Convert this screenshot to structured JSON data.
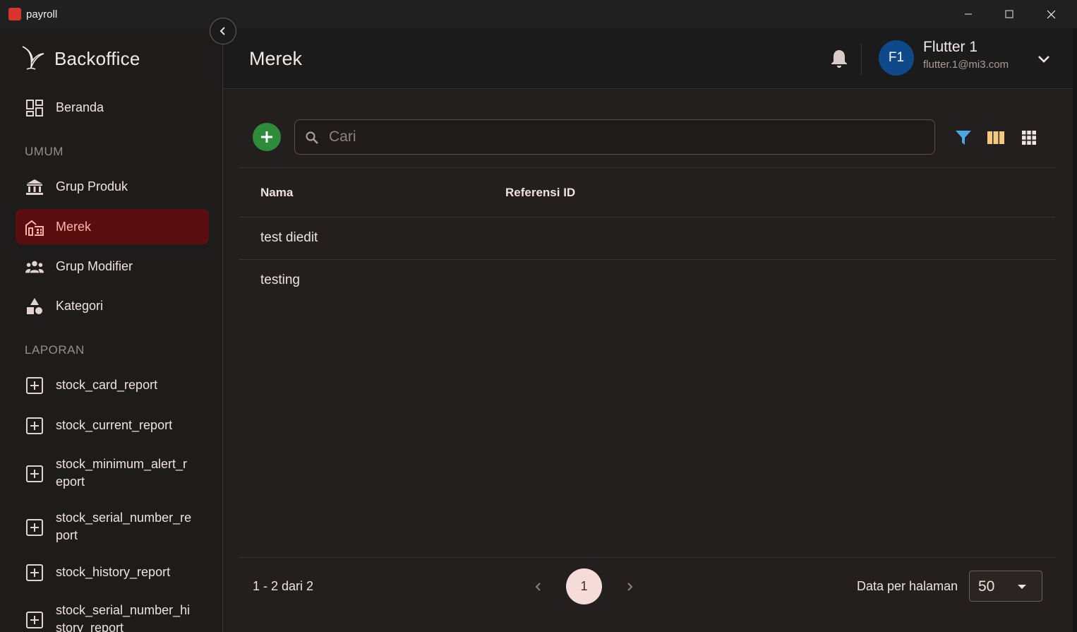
{
  "window": {
    "title": "payroll",
    "accent": "#d9342b"
  },
  "sidebar": {
    "brand": "Backoffice",
    "home": {
      "label": "Beranda",
      "icon": "dashboard-icon"
    },
    "sections": [
      {
        "title": "UMUM",
        "items": [
          {
            "label": "Grup Produk",
            "icon": "bank-icon",
            "active": false
          },
          {
            "label": "Merek",
            "icon": "store-icon",
            "active": true
          },
          {
            "label": "Grup Modifier",
            "icon": "groups-icon",
            "active": false
          },
          {
            "label": "Kategori",
            "icon": "shapes-icon",
            "active": false
          }
        ]
      },
      {
        "title": "LAPORAN",
        "items": [
          {
            "label": "stock_card_report",
            "icon": "add-box-icon"
          },
          {
            "label": "stock_current_report",
            "icon": "add-box-icon"
          },
          {
            "label": "stock_minimum_alert_r\neport",
            "icon": "add-box-icon"
          },
          {
            "label": "stock_serial_number_re\nport",
            "icon": "add-box-icon"
          },
          {
            "label": "stock_history_report",
            "icon": "add-box-icon"
          },
          {
            "label": "stock_serial_number_hi\nstory_report",
            "icon": "add-box-icon"
          }
        ]
      }
    ]
  },
  "header": {
    "title": "Merek",
    "user": {
      "initials": "F1",
      "name": "Flutter 1",
      "email": "flutter.1@mi3.com",
      "avatar_color": "#0e4a8a"
    }
  },
  "toolbar": {
    "search_placeholder": "Cari",
    "add_color": "#2e8b3a",
    "filter_color": "#4aa8e8",
    "columns_color": "#f2c97d"
  },
  "table": {
    "columns": [
      "Nama",
      "Referensi ID"
    ],
    "rows": [
      {
        "nama": "test diedit",
        "ref": ""
      },
      {
        "nama": "testing",
        "ref": ""
      }
    ]
  },
  "pagination": {
    "range": "1 - 2 dari 2",
    "current_page": "1",
    "per_page_label": "Data per halaman",
    "per_page": "50"
  }
}
